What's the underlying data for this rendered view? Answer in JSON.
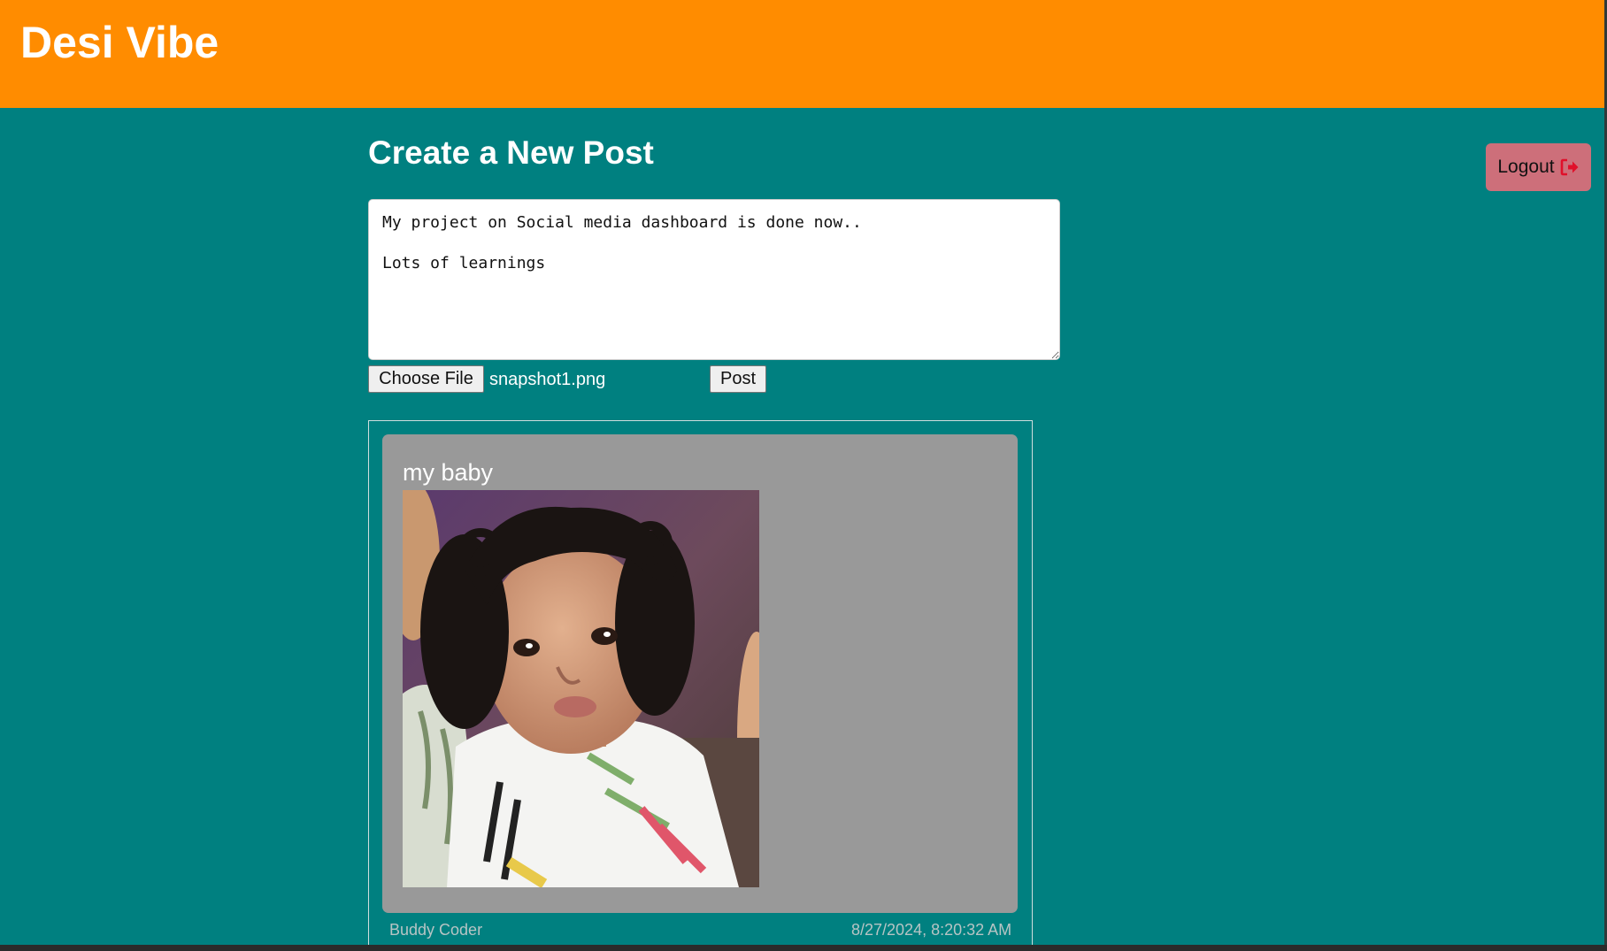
{
  "header": {
    "title": "Desi Vibe",
    "color": "#ff8c00"
  },
  "page": {
    "title": "Create a New Post",
    "background": "#008080"
  },
  "logout": {
    "label": "Logout",
    "icon": "sign-out-icon",
    "icon_color": "#e0102a"
  },
  "composer": {
    "text": "My project on Social media dashboard is done now..\n\nLots of learnings",
    "choose_file_label": "Choose File",
    "file_name": "snapshot1.png",
    "post_label": "Post"
  },
  "posts": [
    {
      "caption": "my baby",
      "image": "photo of a curly-haired toddler in a white printed t-shirt",
      "author": "Buddy Coder",
      "timestamp": "8/27/2024, 8:20:32 AM"
    }
  ]
}
